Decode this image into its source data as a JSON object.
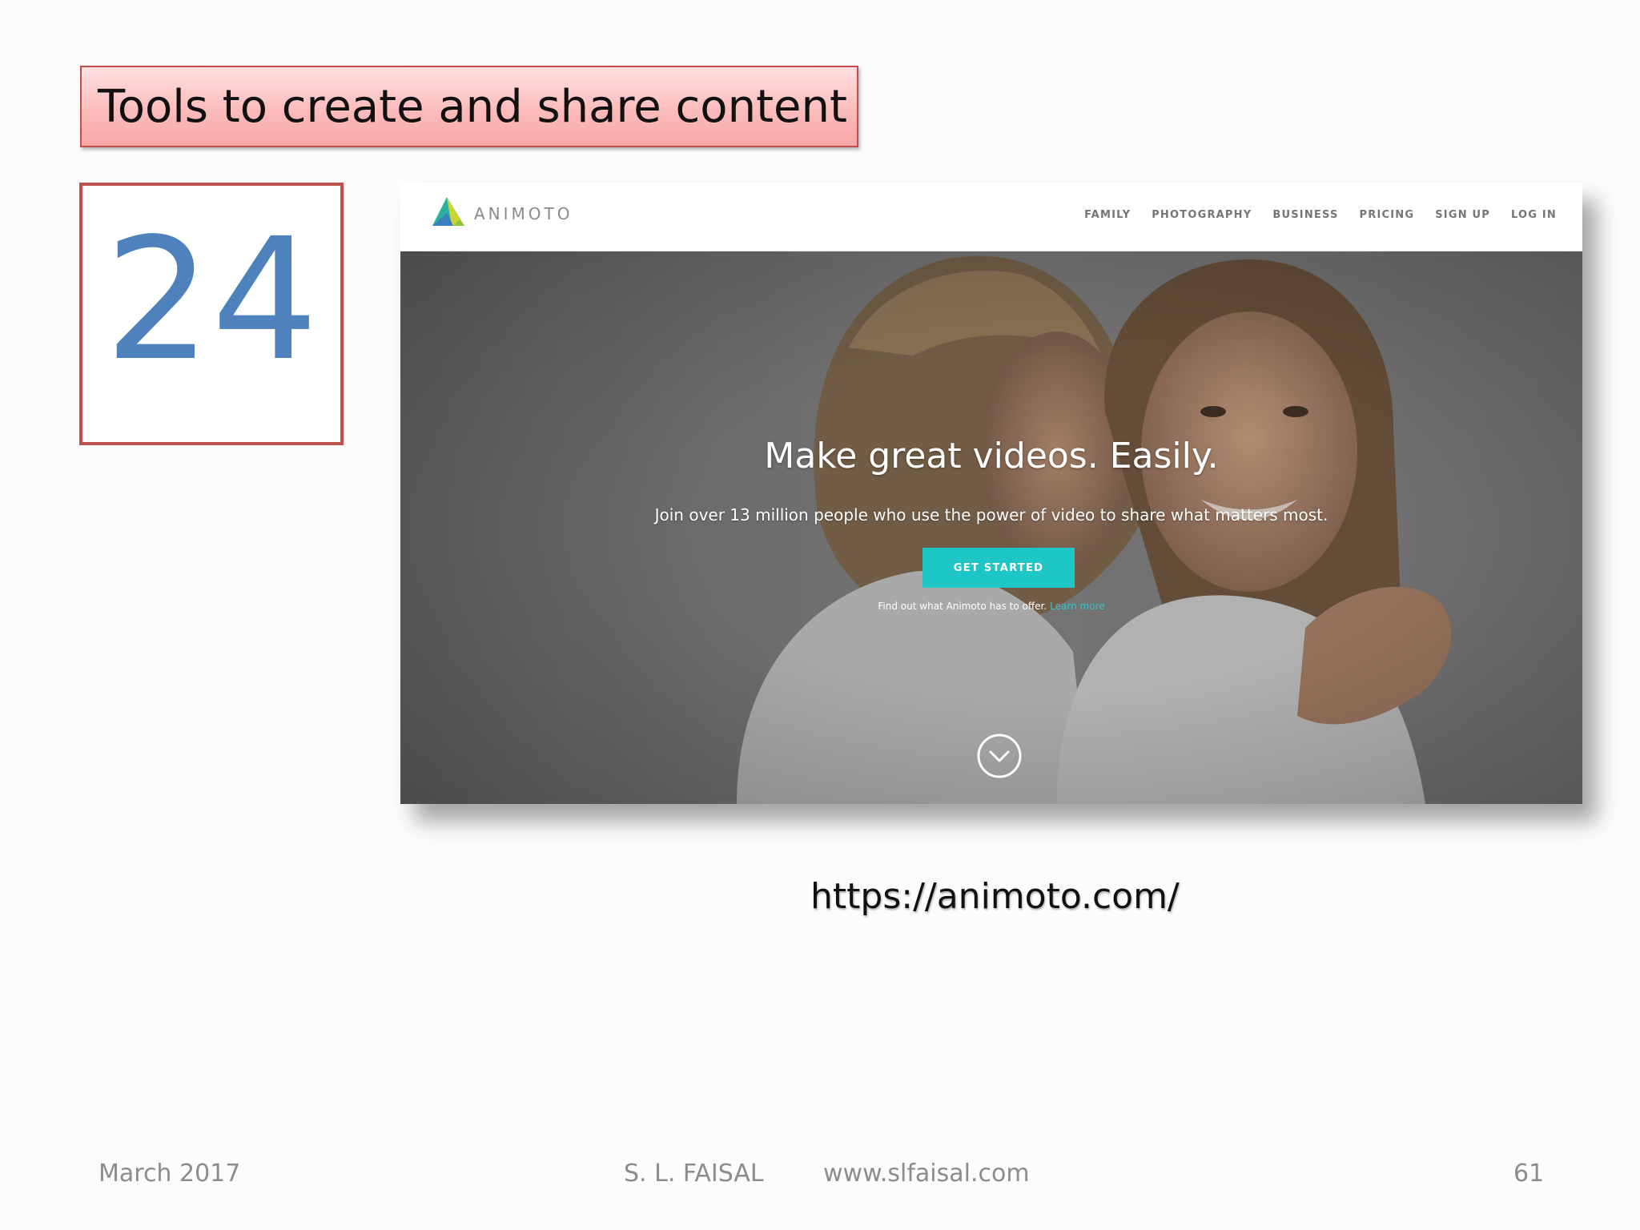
{
  "slide": {
    "title": "Tools to create and share content",
    "number": "24",
    "url": "https://animoto.com/"
  },
  "website": {
    "logo_text": "ANIMOTO",
    "nav": [
      "FAMILY",
      "PHOTOGRAPHY",
      "BUSINESS",
      "PRICING",
      "SIGN UP",
      "LOG IN"
    ],
    "headline": "Make great videos. Easily.",
    "subheadline": "Join over 13 million people who use the power of video to share what matters most.",
    "cta_label": "GET STARTED",
    "find_out_text": "Find out what Animoto has to offer.",
    "learn_more_text": "Learn more"
  },
  "footer": {
    "date": "March 2017",
    "author": "S. L. FAISAL",
    "website": "www.slfaisal.com",
    "page": "61"
  },
  "colors": {
    "title_border": "#c0504d",
    "number_color": "#4f81bd",
    "cta_color": "#1fc6c6",
    "footer_text": "#8c8c8c"
  },
  "icons": [
    "animoto-logo-icon",
    "scroll-down-chevron-icon"
  ]
}
